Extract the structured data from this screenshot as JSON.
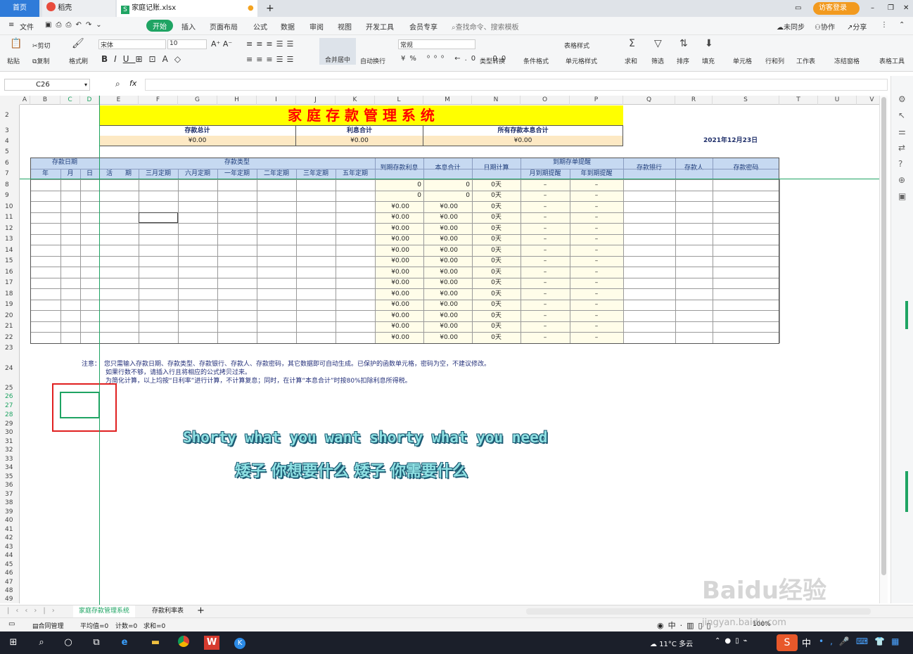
{
  "tabs": {
    "home": "首页",
    "daoke": "稻壳",
    "file": "家庭记账.xlsx",
    "login": "访客登录"
  },
  "menu": {
    "file": "文件",
    "start": "开始",
    "items": [
      "插入",
      "页面布局",
      "公式",
      "数据",
      "审阅",
      "视图",
      "开发工具",
      "会员专享"
    ],
    "search": "查找命令、搜索模板",
    "sync": "未同步",
    "collab": "协作",
    "share": "分享"
  },
  "ribbon": {
    "paste": "粘贴",
    "cut": "剪切",
    "copy": "复制",
    "format_painter": "格式刷",
    "font": "宋体",
    "size": "10",
    "merge": "合并居中",
    "wrap": "自动换行",
    "numfmt": "常规",
    "convert": "类型转换",
    "cond": "条件格式",
    "tablestyle": "表格样式",
    "cellstyle": "单元格样式",
    "sum": "求和",
    "filter": "筛选",
    "sort": "排序",
    "fill": "填充",
    "cellbtn": "单元格",
    "rowcol": "行和列",
    "sheetbtn": "工作表",
    "freeze": "冻结窗格",
    "tabletool": "表格工具"
  },
  "formula": {
    "namebox": "C26"
  },
  "columns": [
    "A",
    "B",
    "C",
    "D",
    "E",
    "F",
    "G",
    "H",
    "I",
    "J",
    "K",
    "L",
    "M",
    "N",
    "O",
    "P",
    "Q",
    "R",
    "S",
    "T",
    "U",
    "V"
  ],
  "rows": [
    "2",
    "3",
    "4",
    "5",
    "6",
    "7",
    "8",
    "9",
    "10",
    "11",
    "12",
    "13",
    "14",
    "15",
    "16",
    "17",
    "18",
    "19",
    "20",
    "21",
    "22",
    "23",
    "24",
    "25",
    "26",
    "27",
    "28",
    "29",
    "30",
    "31",
    "32",
    "33",
    "34",
    "35",
    "36",
    "37",
    "38",
    "39",
    "40",
    "41",
    "42",
    "43",
    "44",
    "45",
    "46",
    "47",
    "48",
    "49"
  ],
  "sheet": {
    "title": "家 庭 存 款 管 理 系 统",
    "sum_labels": [
      "存款总计",
      "利息合计",
      "所有存款本息合计"
    ],
    "sum_values": [
      "¥0.00",
      "¥0.00",
      "¥0.00"
    ],
    "date": "2021年12月23日",
    "header_top": {
      "date": "存款日期",
      "type": "存款类型",
      "interest": "到期存款利息",
      "total": "本息合计",
      "days": "日期计算",
      "remind": "到期存单提醒",
      "bank": "存款银行",
      "person": "存款人",
      "password": "存款密码"
    },
    "header_sub": {
      "year": "年",
      "month": "月",
      "day": "日",
      "types": [
        "活　　期",
        "三月定期",
        "六月定期",
        "一年定期",
        "二年定期",
        "三年定期",
        "五年定期"
      ],
      "remind_month": "月到期提醒",
      "remind_year": "年到期提醒"
    },
    "data_rows": [
      {
        "interest": "0",
        "total": "0",
        "days": "0天",
        "m": "–",
        "y": "–"
      },
      {
        "interest": "0",
        "total": "0",
        "days": "0天",
        "m": "–",
        "y": "–"
      },
      {
        "interest": "¥0.00",
        "total": "¥0.00",
        "days": "0天",
        "m": "–",
        "y": "–"
      },
      {
        "interest": "¥0.00",
        "total": "¥0.00",
        "days": "0天",
        "m": "–",
        "y": "–"
      },
      {
        "interest": "¥0.00",
        "total": "¥0.00",
        "days": "0天",
        "m": "–",
        "y": "–"
      },
      {
        "interest": "¥0.00",
        "total": "¥0.00",
        "days": "0天",
        "m": "–",
        "y": "–"
      },
      {
        "interest": "¥0.00",
        "total": "¥0.00",
        "days": "0天",
        "m": "–",
        "y": "–"
      },
      {
        "interest": "¥0.00",
        "total": "¥0.00",
        "days": "0天",
        "m": "–",
        "y": "–"
      },
      {
        "interest": "¥0.00",
        "total": "¥0.00",
        "days": "0天",
        "m": "–",
        "y": "–"
      },
      {
        "interest": "¥0.00",
        "total": "¥0.00",
        "days": "0天",
        "m": "–",
        "y": "–"
      },
      {
        "interest": "¥0.00",
        "total": "¥0.00",
        "days": "0天",
        "m": "–",
        "y": "–"
      },
      {
        "interest": "¥0.00",
        "total": "¥0.00",
        "days": "0天",
        "m": "–",
        "y": "–"
      },
      {
        "interest": "¥0.00",
        "total": "¥0.00",
        "days": "0天",
        "m": "–",
        "y": "–"
      },
      {
        "interest": "¥0.00",
        "total": "¥0.00",
        "days": "0天",
        "m": "–",
        "y": "–"
      },
      {
        "interest": "¥0.00",
        "total": "¥0.00",
        "days": "0天",
        "m": "–",
        "y": "–"
      }
    ],
    "note_label": "注意：",
    "notes": [
      "您只需输入存款日期、存款类型、存款银行、存款人、存款密码，其它数据即可自动生成。已保护的函数单元格，密码为空，不建议修改。",
      "如果行数不够，请插入行且将相应的公式拷贝过来。",
      "为简化计算，以上均按“日利率”进行计算，不计算复息；同时，在计算“本息合计”时按80%扣除利息所得税。"
    ]
  },
  "lyrics": [
    "Shorty what you want shorty what you need",
    "矮子 你想要什么 矮子 你需要什么"
  ],
  "sheet_tabs": [
    "家庭存款管理系统",
    "存款利率表"
  ],
  "status": {
    "manage": "合同管理",
    "avg": "平均值=0",
    "count": "计数=0",
    "sum": "求和=0",
    "zoom": "100%"
  },
  "taskbar": {
    "weather": "11°C 多云",
    "ime": "中"
  },
  "watermark": {
    "brand": "Baidu经验",
    "url": "jingyan.baidu.com"
  },
  "colors": {
    "accent": "#1fa463",
    "title_yellow": "#ffff00",
    "title_red": "#ff0000",
    "header_blue": "#c6d9f1",
    "selection_red": "#e02020"
  }
}
